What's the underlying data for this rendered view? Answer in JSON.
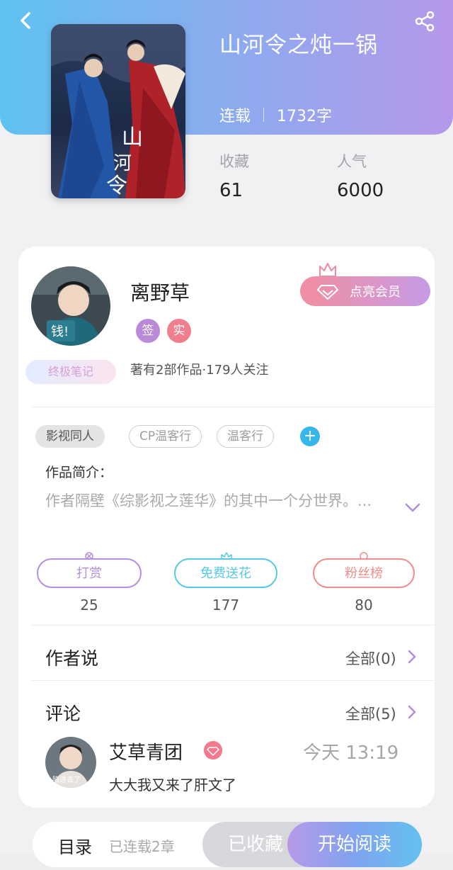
{
  "book": {
    "title": "山河令之炖一锅",
    "status": "连载",
    "word_count": "1732字",
    "stats": [
      {
        "label": "收藏",
        "value": "61"
      },
      {
        "label": "人气",
        "value": "6000"
      }
    ],
    "cover_text": "山河令"
  },
  "author": {
    "name": "离野草",
    "tags": [
      {
        "label": "签",
        "color": "#b98ad9"
      },
      {
        "label": "实",
        "color": "#f07e8e"
      }
    ],
    "info": "著有2部作品·179人关注",
    "badge": "终极笔记",
    "avatar_text": "钱!",
    "vip_button": "点亮会员"
  },
  "work_tags": [
    "影视同人",
    "CP温客行",
    "温客行"
  ],
  "intro": {
    "label": "作品简介：",
    "text": "作者隔壁《综影视之莲华》的其中一个分世界。..."
  },
  "actions": [
    {
      "label": "打赏",
      "count": "25",
      "color": "#b58ee0"
    },
    {
      "label": "免费送花",
      "count": "177",
      "color": "#56c8e6"
    },
    {
      "label": "粉丝榜",
      "count": "80",
      "color": "#f08c8c"
    }
  ],
  "author_says": {
    "title": "作者说",
    "link": "全部(0)"
  },
  "comments": {
    "title": "评论",
    "link": "全部(5)",
    "items": [
      {
        "name": "艾草青团",
        "time": "今天 13:19",
        "text": "大大我又来了肝文了",
        "avatar_text": "陷进去了"
      }
    ]
  },
  "bottom_bar": {
    "toc": "目录",
    "chapters": "已连载2章",
    "collected": "已收藏",
    "read": "开始阅读"
  },
  "colors": {
    "accent_purple": "#b48be0",
    "accent_blue": "#36b7ec",
    "header_gradient": [
      "#5fc2f0",
      "#b698ea"
    ]
  }
}
